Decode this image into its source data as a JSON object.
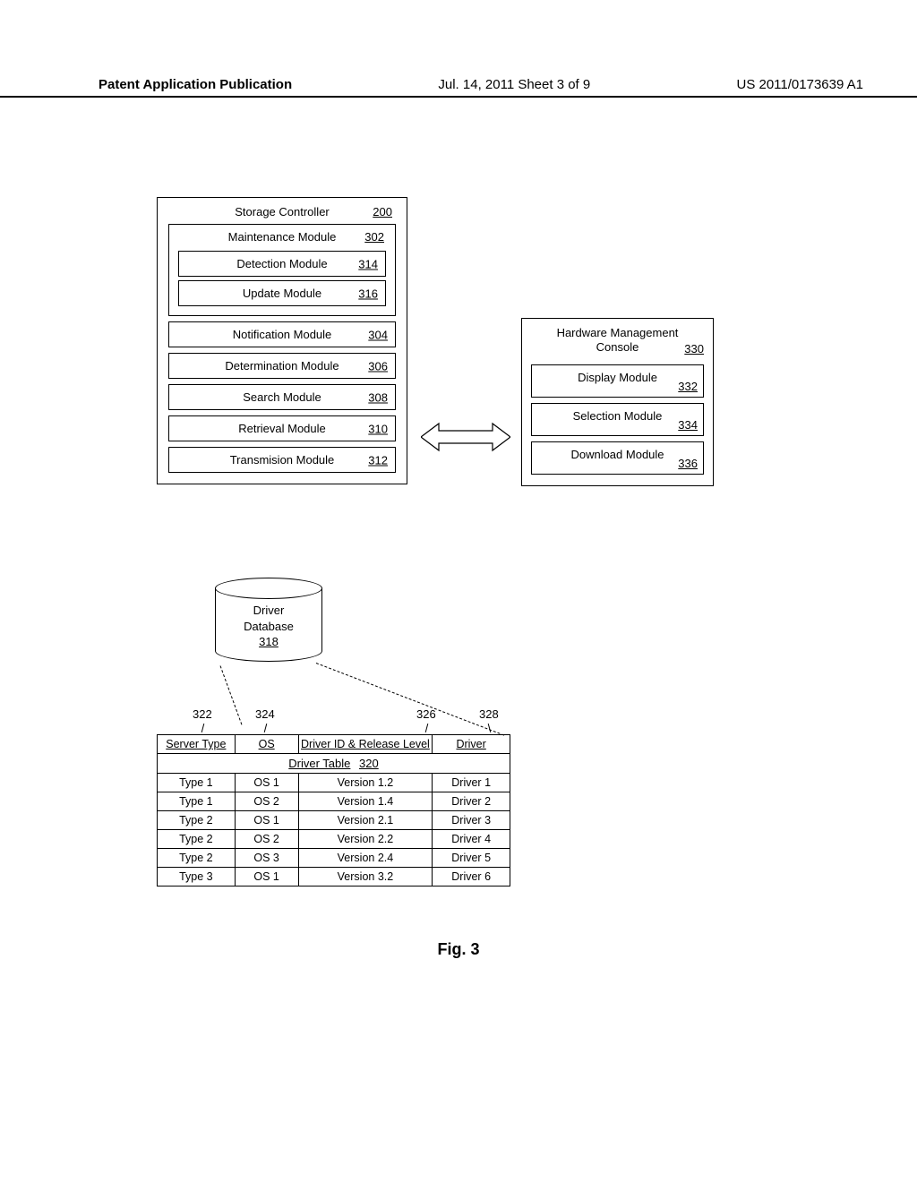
{
  "header": {
    "left": "Patent Application Publication",
    "center": "Jul. 14, 2011  Sheet 3 of 9",
    "right": "US 2011/0173639 A1"
  },
  "storage_controller": {
    "title": "Storage Controller",
    "ref": "200"
  },
  "maintenance": {
    "title": "Maintenance Module",
    "ref": "302",
    "detection": {
      "label": "Detection Module",
      "ref": "314"
    },
    "update": {
      "label": "Update Module",
      "ref": "316"
    }
  },
  "modules": {
    "notification": {
      "label": "Notification Module",
      "ref": "304"
    },
    "determination": {
      "label": "Determination Module",
      "ref": "306"
    },
    "search": {
      "label": "Search Module",
      "ref": "308"
    },
    "retrieval": {
      "label": "Retrieval Module",
      "ref": "310"
    },
    "transmission": {
      "label": "Transmision Module",
      "ref": "312"
    }
  },
  "database": {
    "line1": "Driver",
    "line2": "Database",
    "ref": "318"
  },
  "col_refs": {
    "c1": "322",
    "c2": "324",
    "c3": "326",
    "c4": "328"
  },
  "table": {
    "title": "Driver Table",
    "title_ref": "320",
    "headers": {
      "server_type": "Server Type",
      "os": "OS",
      "driver_id": "Driver ID & Release Level",
      "driver": "Driver"
    },
    "rows": [
      {
        "server_type": "Type 1",
        "os": "OS 1",
        "version": "Version 1.2",
        "driver": "Driver 1"
      },
      {
        "server_type": "Type 1",
        "os": "OS 2",
        "version": "Version 1.4",
        "driver": "Driver 2"
      },
      {
        "server_type": "Type 2",
        "os": "OS 1",
        "version": "Version 2.1",
        "driver": "Driver 3"
      },
      {
        "server_type": "Type 2",
        "os": "OS 2",
        "version": "Version 2.2",
        "driver": "Driver 4"
      },
      {
        "server_type": "Type 2",
        "os": "OS 3",
        "version": "Version 2.4",
        "driver": "Driver 5"
      },
      {
        "server_type": "Type 3",
        "os": "OS 1",
        "version": "Version 3.2",
        "driver": "Driver 6"
      }
    ]
  },
  "hmc": {
    "title_line1": "Hardware Management",
    "title_line2": "Console",
    "ref": "330",
    "display": {
      "label": "Display Module",
      "ref": "332"
    },
    "selection": {
      "label": "Selection Module",
      "ref": "334"
    },
    "download": {
      "label": "Download Module",
      "ref": "336"
    }
  },
  "figure_label": "Fig. 3",
  "chart_data": {
    "type": "table",
    "title": "Driver Table 320",
    "columns": [
      "Server Type",
      "OS",
      "Driver ID & Release Level",
      "Driver"
    ],
    "rows": [
      [
        "Type 1",
        "OS 1",
        "Version 1.2",
        "Driver 1"
      ],
      [
        "Type 1",
        "OS 2",
        "Version 1.4",
        "Driver 2"
      ],
      [
        "Type 2",
        "OS 1",
        "Version 2.1",
        "Driver 3"
      ],
      [
        "Type 2",
        "OS 2",
        "Version 2.2",
        "Driver 4"
      ],
      [
        "Type 2",
        "OS 3",
        "Version 2.4",
        "Driver 5"
      ],
      [
        "Type 3",
        "OS 1",
        "Version 3.2",
        "Driver 6"
      ]
    ]
  }
}
